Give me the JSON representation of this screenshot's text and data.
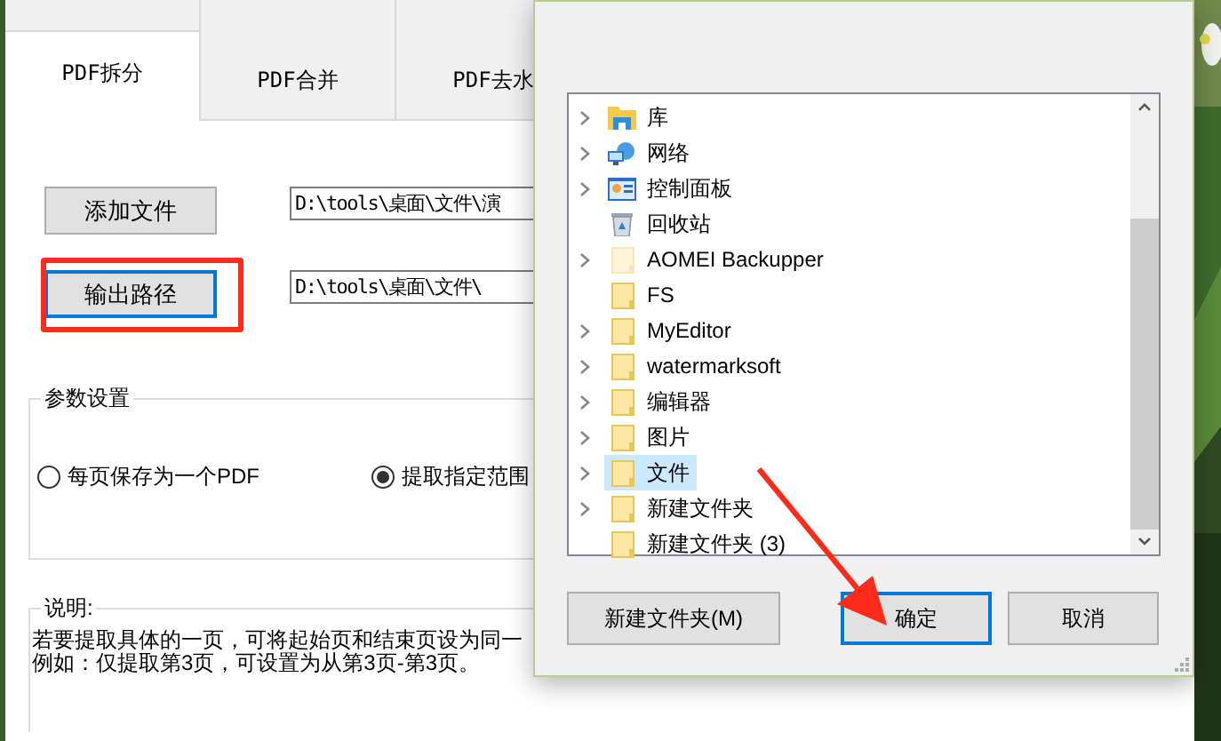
{
  "tabs": [
    {
      "label": "PDF拆分",
      "selected": true
    },
    {
      "label": "PDF合并",
      "selected": false
    },
    {
      "label": "PDF去水",
      "selected": false
    }
  ],
  "file_rows": [
    {
      "button": "添加文件",
      "path": "D:\\tools\\桌面\\文件\\演",
      "focused": false,
      "highlighted": false
    },
    {
      "button": "输出路径",
      "path": "D:\\tools\\桌面\\文件\\",
      "focused": true,
      "highlighted": true
    }
  ],
  "params": {
    "title": "参数设置",
    "options": [
      {
        "label": "每页保存为一个PDF",
        "selected": false
      },
      {
        "label": "提取指定范围",
        "selected": true
      }
    ]
  },
  "notes": {
    "title": "说明:",
    "lines": [
      "若要提取具体的一页，可将起始页和结束页设为同一",
      "例如：仅提取第3页，可设置为从第3页-第3页。"
    ]
  },
  "dialog": {
    "tree": [
      {
        "label": "库",
        "kind": "library",
        "expandable": true,
        "selected": false,
        "faded": false
      },
      {
        "label": "网络",
        "kind": "network",
        "expandable": true,
        "selected": false,
        "faded": false
      },
      {
        "label": "控制面板",
        "kind": "control-panel",
        "expandable": true,
        "selected": false,
        "faded": false
      },
      {
        "label": "回收站",
        "kind": "recycle-bin",
        "expandable": false,
        "selected": false,
        "faded": false
      },
      {
        "label": "AOMEI Backupper",
        "kind": "folder",
        "expandable": true,
        "selected": false,
        "faded": true
      },
      {
        "label": "FS",
        "kind": "folder",
        "expandable": false,
        "selected": false,
        "faded": false
      },
      {
        "label": "MyEditor",
        "kind": "folder",
        "expandable": true,
        "selected": false,
        "faded": false
      },
      {
        "label": "watermarksoft",
        "kind": "folder",
        "expandable": true,
        "selected": false,
        "faded": false
      },
      {
        "label": "编辑器",
        "kind": "folder",
        "expandable": true,
        "selected": false,
        "faded": false
      },
      {
        "label": "图片",
        "kind": "folder",
        "expandable": true,
        "selected": false,
        "faded": false
      },
      {
        "label": "文件",
        "kind": "folder",
        "expandable": true,
        "selected": true,
        "faded": false
      },
      {
        "label": "新建文件夹",
        "kind": "folder",
        "expandable": true,
        "selected": false,
        "faded": false
      },
      {
        "label": "新建文件夹 (3)",
        "kind": "folder",
        "expandable": false,
        "selected": false,
        "faded": false
      }
    ],
    "buttons": [
      {
        "label": "新建文件夹(M)",
        "default": false
      },
      {
        "label": "确定",
        "default": true
      },
      {
        "label": "取消",
        "default": false
      }
    ]
  }
}
